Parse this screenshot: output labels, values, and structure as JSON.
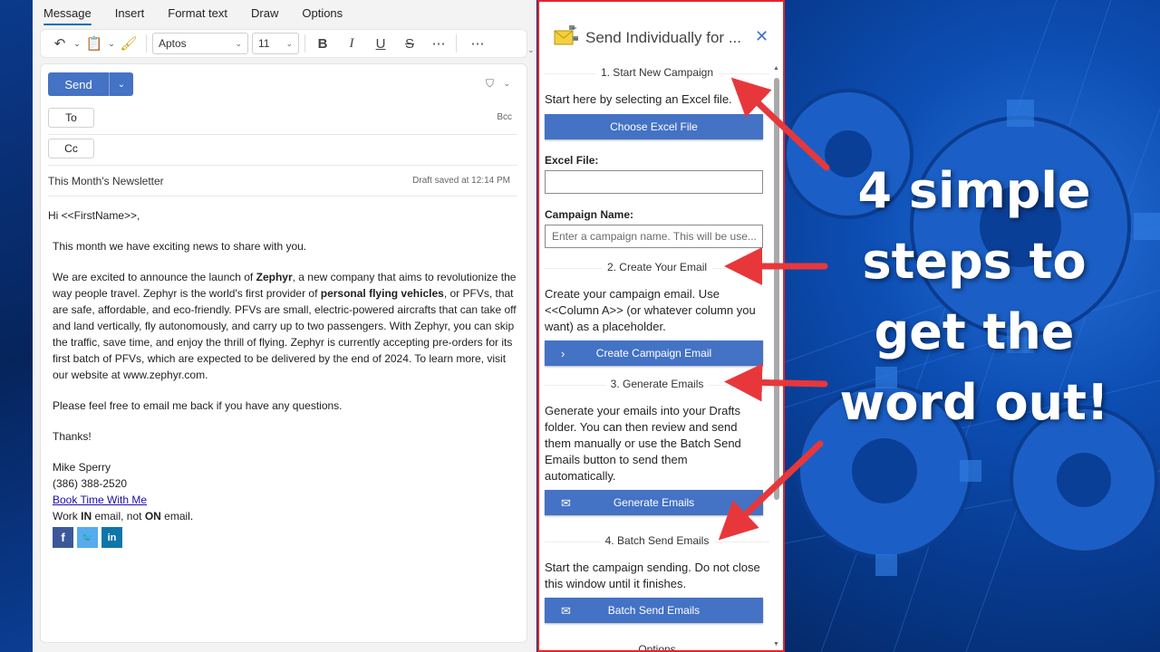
{
  "ribbon": {
    "tabs": [
      "Message",
      "Insert",
      "Format text",
      "Draw",
      "Options"
    ],
    "font_name": "Aptos",
    "font_size": "11"
  },
  "compose": {
    "send_label": "Send",
    "to_label": "To",
    "cc_label": "Cc",
    "bcc_label": "Bcc",
    "subject": "This Month's Newsletter",
    "draft_status": "Draft saved at 12:14 PM",
    "greeting": "Hi <<FirstName>>,",
    "para1": "This month we have exciting news to share with you.",
    "para2_a": "We are excited to announce the launch of ",
    "para2_b": "Zephyr",
    "para2_c": ", a new company that aims to revolutionize the way people travel. Zephyr is the world's first provider of ",
    "para2_d": "personal flying vehicles",
    "para2_e": ", or PFVs, that are safe, affordable, and eco-friendly. PFVs are small, electric-powered aircrafts that can take off and land vertically, fly autonomously, and carry up to two passengers. With Zephyr, you can skip the traffic, save time, and enjoy the thrill of flying. Zephyr is currently accepting pre-orders for its first batch of PFVs, which are expected to be delivered by the end of 2024. To learn more, visit our website at www.zephyr.com.",
    "para3": "Please feel free to email me back if you have any questions.",
    "thanks": "Thanks!",
    "sig_name": "Mike Sperry",
    "sig_phone": "(386) 388-2520",
    "sig_link": "Book Time With Me",
    "sig_tag_a": "Work ",
    "sig_tag_b": "IN",
    "sig_tag_c": " email, not ",
    "sig_tag_d": "ON",
    "sig_tag_e": " email.",
    "social": [
      {
        "icon": "facebook-icon",
        "glyph": "f",
        "color": "#3b5998"
      },
      {
        "icon": "twitter-icon",
        "glyph": "🐦",
        "color": "#55acee"
      },
      {
        "icon": "linkedin-icon",
        "glyph": "in",
        "color": "#0e76a8"
      }
    ]
  },
  "panel": {
    "title": "Send Individually for ...",
    "step1_title": "1. Start New Campaign",
    "step1_text": "Start here by selecting an Excel file.",
    "choose_excel": "Choose Excel File",
    "excel_label": "Excel File:",
    "excel_value": "",
    "campaign_label": "Campaign Name:",
    "campaign_placeholder": "Enter a campaign name.  This will be use...",
    "step2_title": "2. Create Your Email",
    "step2_text": "Create your campaign email. Use <<Column A>> (or whatever column you want) as a placeholder.",
    "create_email": "Create Campaign Email",
    "step3_title": "3. Generate Emails",
    "step3_text": "Generate your emails into your Drafts folder. You can then review and send them manually or use the Batch Send Emails button to send them automatically.",
    "generate": "Generate Emails",
    "step4_title": "4. Batch Send Emails",
    "step4_text": "Start the campaign sending. Do not close this window until it finishes.",
    "batch_send": "Batch Send Emails",
    "options": "Options"
  },
  "callout": {
    "lines": [
      "4 simple",
      "steps to",
      "get the",
      "word out!"
    ]
  },
  "colors": {
    "accent": "#4472c4",
    "highlight": "#e8242a"
  }
}
